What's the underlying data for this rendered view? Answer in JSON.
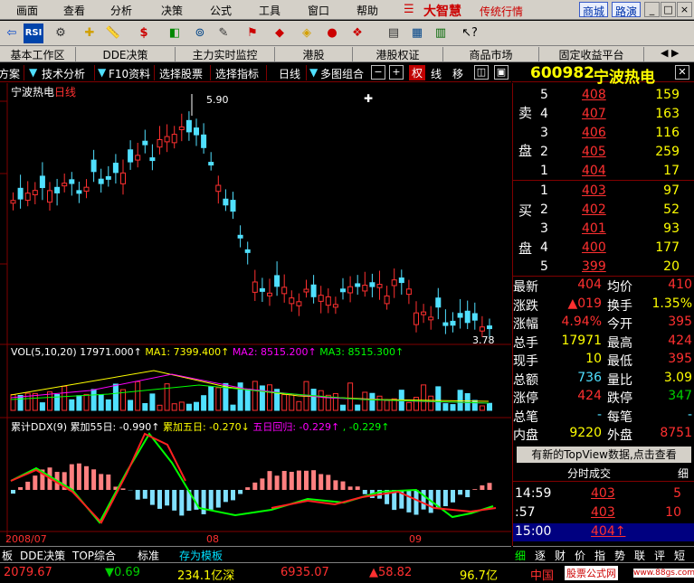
{
  "menu": {
    "items": [
      "画面",
      "查看",
      "分析",
      "决策",
      "公式",
      "工具",
      "窗口",
      "帮助"
    ],
    "brand": "大智慧",
    "brand_sub": "传统行情",
    "pills": [
      "商城",
      "路演"
    ],
    "min": "_",
    "max": "□",
    "close": "×"
  },
  "toolbar": {
    "icons": [
      "back-icon",
      "rsi-icon",
      "gear-icon",
      "cross-icon",
      "ruler-icon",
      "dollar-icon",
      "compare-icon",
      "binoculars-icon",
      "pen-icon",
      "flag-icon",
      "diamond-icon",
      "lips-icon",
      "play-icon",
      "chart-icon",
      "list-icon",
      "calendar-icon",
      "bars-icon",
      "help-icon"
    ],
    "rsi": "RSI"
  },
  "tabs": [
    {
      "label": "基本工作区"
    },
    {
      "label": "DDE决策"
    },
    {
      "label": "主力实时监控"
    },
    {
      "label": "港股"
    },
    {
      "label": "港股权证"
    },
    {
      "label": "商品市场"
    },
    {
      "label": "固定收益平台"
    }
  ],
  "chartbar": {
    "items": [
      "方案",
      "技术分析",
      "F10资料",
      "选择股票",
      "选择指标",
      "日线",
      "多图组合"
    ],
    "quan": "权",
    "xian": "线",
    "yi": "移"
  },
  "stock": {
    "code": "600982",
    "name": "宁波热电"
  },
  "chart": {
    "title": "宁波热电",
    "period": "日线",
    "high": "5.90",
    "low": "3.78",
    "vol_label": "VOL(5,10,20)",
    "vol_val": "17971.000↑",
    "ma1": "MA1: 7399.400↑",
    "ma2": "MA2: 8515.200↑",
    "ma3": "MA3: 8515.300↑",
    "ddx_label": "累计DDX(9)",
    "ddx1": "累加55日: -0.990↑",
    "ddx2": "累加五日: -0.270↓",
    "ddx3": "五日回归: -0.229↑",
    "ddx4": ", -0.229↑",
    "date1": "2008/07",
    "date2": "08",
    "date3": "09"
  },
  "orderbook": {
    "sell_label": [
      "卖",
      "盘"
    ],
    "buy_label": [
      "买",
      "盘"
    ],
    "sell": [
      {
        "n": "5",
        "p": "408",
        "v": "159"
      },
      {
        "n": "4",
        "p": "407",
        "v": "163"
      },
      {
        "n": "3",
        "p": "406",
        "v": "116"
      },
      {
        "n": "2",
        "p": "405",
        "v": "259"
      },
      {
        "n": "1",
        "p": "404",
        "v": "17"
      }
    ],
    "buy": [
      {
        "n": "1",
        "p": "403",
        "v": "97"
      },
      {
        "n": "2",
        "p": "402",
        "v": "52"
      },
      {
        "n": "3",
        "p": "401",
        "v": "93"
      },
      {
        "n": "4",
        "p": "400",
        "v": "177"
      },
      {
        "n": "5",
        "p": "399",
        "v": "20"
      }
    ]
  },
  "quote": [
    {
      "l1": "最新",
      "v1": "404",
      "l2": "均价",
      "v2": "410"
    },
    {
      "l1": "涨跌",
      "v1": "▲019",
      "l2": "换手",
      "v2": "1.35%"
    },
    {
      "l1": "涨幅",
      "v1": "4.94%",
      "l2": "今开",
      "v2": "395"
    },
    {
      "l1": "总手",
      "v1": "17971",
      "l2": "最高",
      "v2": "424"
    },
    {
      "l1": "现手",
      "v1": "10",
      "l2": "最低",
      "v2": "395"
    },
    {
      "l1": "总额",
      "v1": "736",
      "l2": "量比",
      "v2": "3.09"
    },
    {
      "l1": "涨停",
      "v1": "424",
      "l2": "跌停",
      "v2": "347"
    },
    {
      "l1": "总笔",
      "v1": "-",
      "l2": "每笔",
      "v2": "-"
    },
    {
      "l1": "内盘",
      "v1": "9220",
      "l2": "外盘",
      "v2": "8751"
    }
  ],
  "topview": "有新的TopView数据,点击查看",
  "ticks": {
    "title": "分时成交",
    "tab": "细",
    "rows": [
      {
        "t": "14:59",
        "p": "403",
        "v": "5"
      },
      {
        "t": ":57",
        "p": "403",
        "v": "10"
      },
      {
        "t": "15:00",
        "p": "404↑",
        "v": ""
      }
    ]
  },
  "paneltabs": [
    "细",
    "逐",
    "财",
    "价",
    "指",
    "势",
    "联",
    "评",
    "短"
  ],
  "bottomtabs": [
    "板",
    "DDE决策",
    "TOP综合",
    "标准",
    "存为模板"
  ],
  "status": {
    "s1": "2079.67",
    "s2": "▼0.69",
    "s3": "234.1亿深",
    "s4": "6935.07",
    "s5": "▲58.82",
    "s6": "96.7亿",
    "s7": "中国",
    "s8": "股票公式网",
    "s9": "www.88gs.com"
  }
}
